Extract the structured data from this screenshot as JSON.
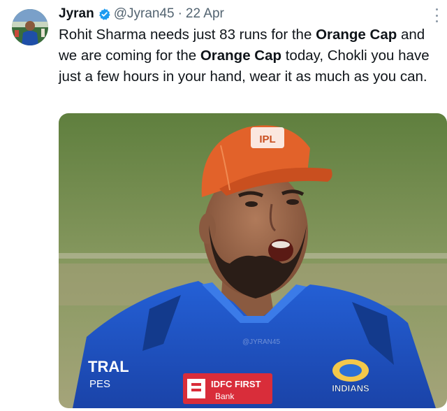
{
  "tweet": {
    "author_name": "Jyran",
    "handle": "@Jyran45",
    "separator": "·",
    "date": "22 Apr",
    "text_segments": [
      {
        "text": "Rohit Sharma needs just 83 runs for the ",
        "bold": false
      },
      {
        "text": "Orange Cap",
        "bold": true
      },
      {
        "text": " and we are coming for the ",
        "bold": false
      },
      {
        "text": "Orange Cap",
        "bold": true
      },
      {
        "text": " today, Chokli you have just a few hours in your hand, wear it as much as you can.",
        "bold": false
      }
    ],
    "media": {
      "cap_logo_text": "IPL",
      "sponsor_text_line1": "IDFC FIRST",
      "sponsor_text_line2": "Bank",
      "team_logo_text": "INDIANS",
      "sleeve_text_line1": "TRAL",
      "sleeve_text_line2": "PES",
      "watermark_text": "@JYRAN45"
    }
  },
  "icons": {
    "verified": "verified-badge-icon",
    "more": "more-options-icon"
  },
  "colors": {
    "verified_blue": "#1d9bf0",
    "secondary_text": "#536471",
    "jersey_blue": "#1c4fbf",
    "cap_orange": "#e2622a"
  }
}
